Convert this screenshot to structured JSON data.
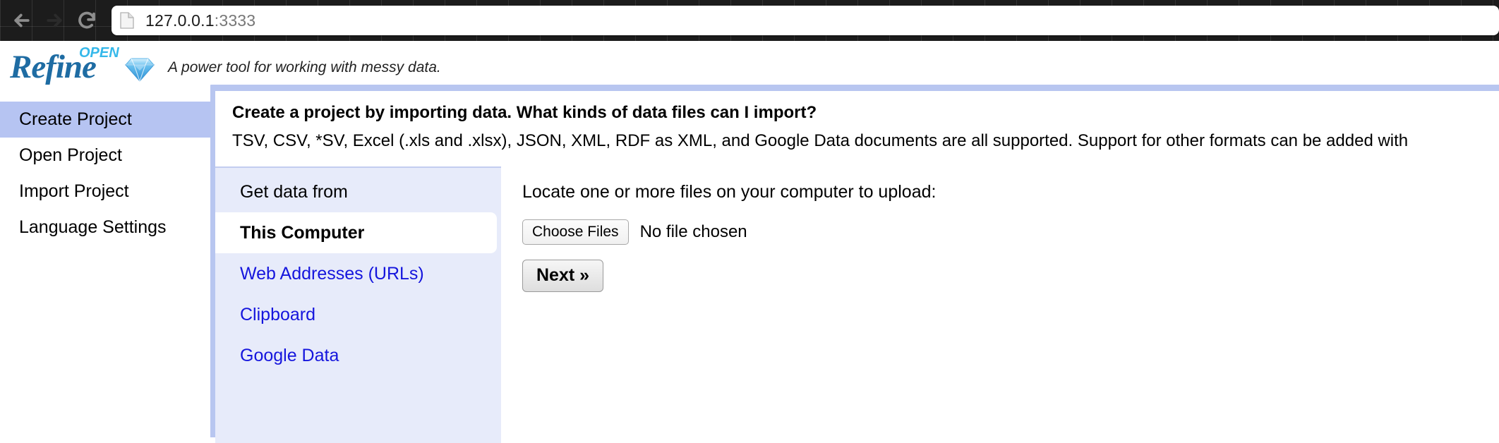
{
  "browser": {
    "back_icon": "arrow-left-icon",
    "forward_icon": "arrow-right-icon",
    "reload_icon": "reload-icon",
    "page_icon": "page-document-icon",
    "url_host": "127.0.0.1",
    "url_port": ":3333"
  },
  "header": {
    "logo_word": "Refine",
    "logo_open": "OPEN",
    "logo_gem_icon": "diamond-gem-icon",
    "tagline": "A power tool for working with messy data."
  },
  "sidebar": {
    "items": [
      {
        "label": "Create Project",
        "selected": true
      },
      {
        "label": "Open Project",
        "selected": false
      },
      {
        "label": "Import Project",
        "selected": false
      },
      {
        "label": "Language Settings",
        "selected": false
      }
    ]
  },
  "panel": {
    "title": "Create a project by importing data. What kinds of data files can I import?",
    "description": "TSV, CSV, *SV, Excel (.xls and .xlsx), JSON, XML, RDF as XML, and Google Data documents are all supported. Support for other formats can be added with",
    "sources": [
      {
        "label": "Get data from",
        "type": "heading"
      },
      {
        "label": "This Computer",
        "type": "active"
      },
      {
        "label": "Web Addresses (URLs)",
        "type": "link"
      },
      {
        "label": "Clipboard",
        "type": "link"
      },
      {
        "label": "Google Data",
        "type": "link"
      }
    ],
    "uploader": {
      "label": "Locate one or more files on your computer to upload:",
      "choose_files_label": "Choose Files",
      "file_status": "No file chosen",
      "next_label": "Next »"
    }
  },
  "colors": {
    "accent_border": "#b8c6f0",
    "sidebar_selected": "#b6c4f2",
    "source_panel_bg": "#e7ebfa",
    "link": "#1515dd",
    "logo_blue": "#1e6ca3",
    "logo_cyan": "#35b8ea"
  }
}
